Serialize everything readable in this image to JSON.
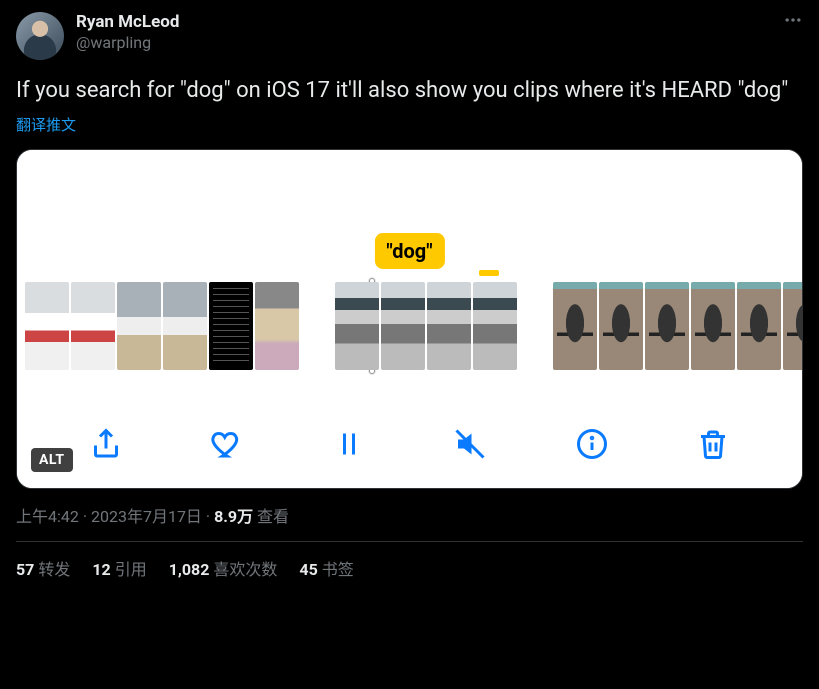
{
  "author": {
    "display_name": "Ryan McLeod",
    "handle": "@warpling"
  },
  "tweet": {
    "text": "If you search for \"dog\" on iOS 17 it'll also show you clips where it's HEARD \"dog\"",
    "translate_label": "翻译推文",
    "caption_tag": "\"dog\"",
    "alt_label": "ALT"
  },
  "meta": {
    "time": "上午4:42",
    "date": "2023年7月17日",
    "views_count": "8.9万",
    "views_label": "查看",
    "separator": " · "
  },
  "stats": {
    "retweets": {
      "count": "57",
      "label": "转发"
    },
    "quotes": {
      "count": "12",
      "label": "引用"
    },
    "likes": {
      "count": "1,082",
      "label": "喜欢次数"
    },
    "bookmarks": {
      "count": "45",
      "label": "书签"
    }
  },
  "icons": {
    "share": "share-icon",
    "heart": "heart-icon",
    "pause": "pause-icon",
    "mute": "mute-icon",
    "info": "info-icon",
    "trash": "trash-icon",
    "more": "more-icon"
  }
}
